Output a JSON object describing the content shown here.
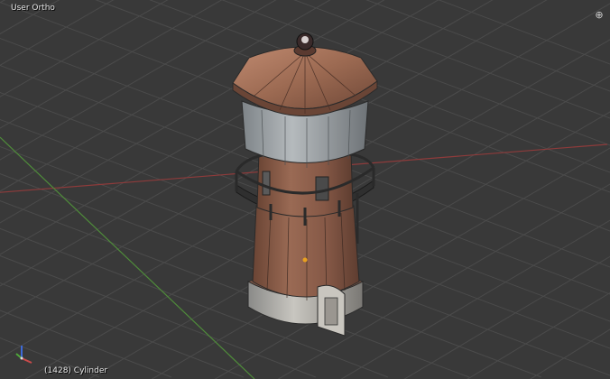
{
  "viewport": {
    "view_label": "User Ortho",
    "object_info": "(1428) Cylinder",
    "corner_icon": "view-split-icon",
    "axis_gizmo_icon": "axis-gizmo-icon",
    "colors": {
      "background": "#393939",
      "grid": "#4a4a4a",
      "x_axis": "#9b3a3a",
      "y_axis": "#4f8a3a",
      "brick": "#8a5e4a",
      "roof": "#a06b52",
      "plaster": "#9aa0a4",
      "metal": "#3c3c3c"
    }
  }
}
